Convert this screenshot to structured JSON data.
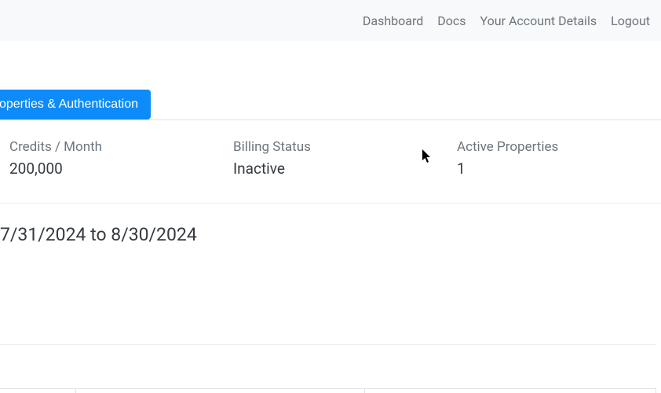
{
  "nav": {
    "dashboard": "Dashboard",
    "docs": "Docs",
    "account": "Your Account Details",
    "logout": "Logout"
  },
  "tabs": {
    "properties_auth": "operties & Authentication"
  },
  "stats": {
    "credits_label": "Credits / Month",
    "credits_value": "200,000",
    "billing_label": "Billing Status",
    "billing_value": "Inactive",
    "active_props_label": "Active Properties",
    "active_props_value": "1"
  },
  "period": {
    "text": "7/31/2024 to 8/30/2024"
  }
}
